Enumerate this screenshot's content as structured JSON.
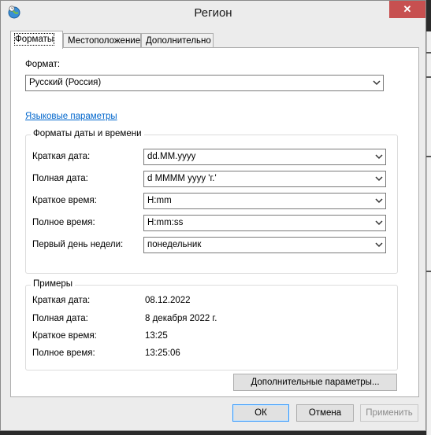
{
  "window": {
    "title": "Регион",
    "close_glyph": "✕"
  },
  "tabs": [
    {
      "label": "Форматы",
      "active": true
    },
    {
      "label": "Местоположение",
      "active": false
    },
    {
      "label": "Дополнительно",
      "active": false
    }
  ],
  "format": {
    "label": "Формат:",
    "value": "Русский (Россия)"
  },
  "language_link": "Языковые параметры",
  "datetime_group": {
    "title": "Форматы даты и времени",
    "rows": [
      {
        "label": "Краткая дата:",
        "value": "dd.MM.yyyy"
      },
      {
        "label": "Полная дата:",
        "value": "d MMMM yyyy 'г.'"
      },
      {
        "label": "Краткое время:",
        "value": "H:mm"
      },
      {
        "label": "Полное время:",
        "value": "H:mm:ss"
      },
      {
        "label": "Первый день недели:",
        "value": "понедельник"
      }
    ]
  },
  "examples_group": {
    "title": "Примеры",
    "rows": [
      {
        "label": "Краткая дата:",
        "value": "08.12.2022"
      },
      {
        "label": "Полная дата:",
        "value": "8 декабря 2022 г."
      },
      {
        "label": "Краткое время:",
        "value": "13:25"
      },
      {
        "label": "Полное время:",
        "value": "13:25:06"
      }
    ]
  },
  "buttons": {
    "advanced": "Дополнительные параметры...",
    "ok": "ОК",
    "cancel": "Отмена",
    "apply": "Применить"
  },
  "icons": {
    "app": "globe-clock-icon",
    "close": "close-icon",
    "dropdown": "chevron-down-icon"
  }
}
